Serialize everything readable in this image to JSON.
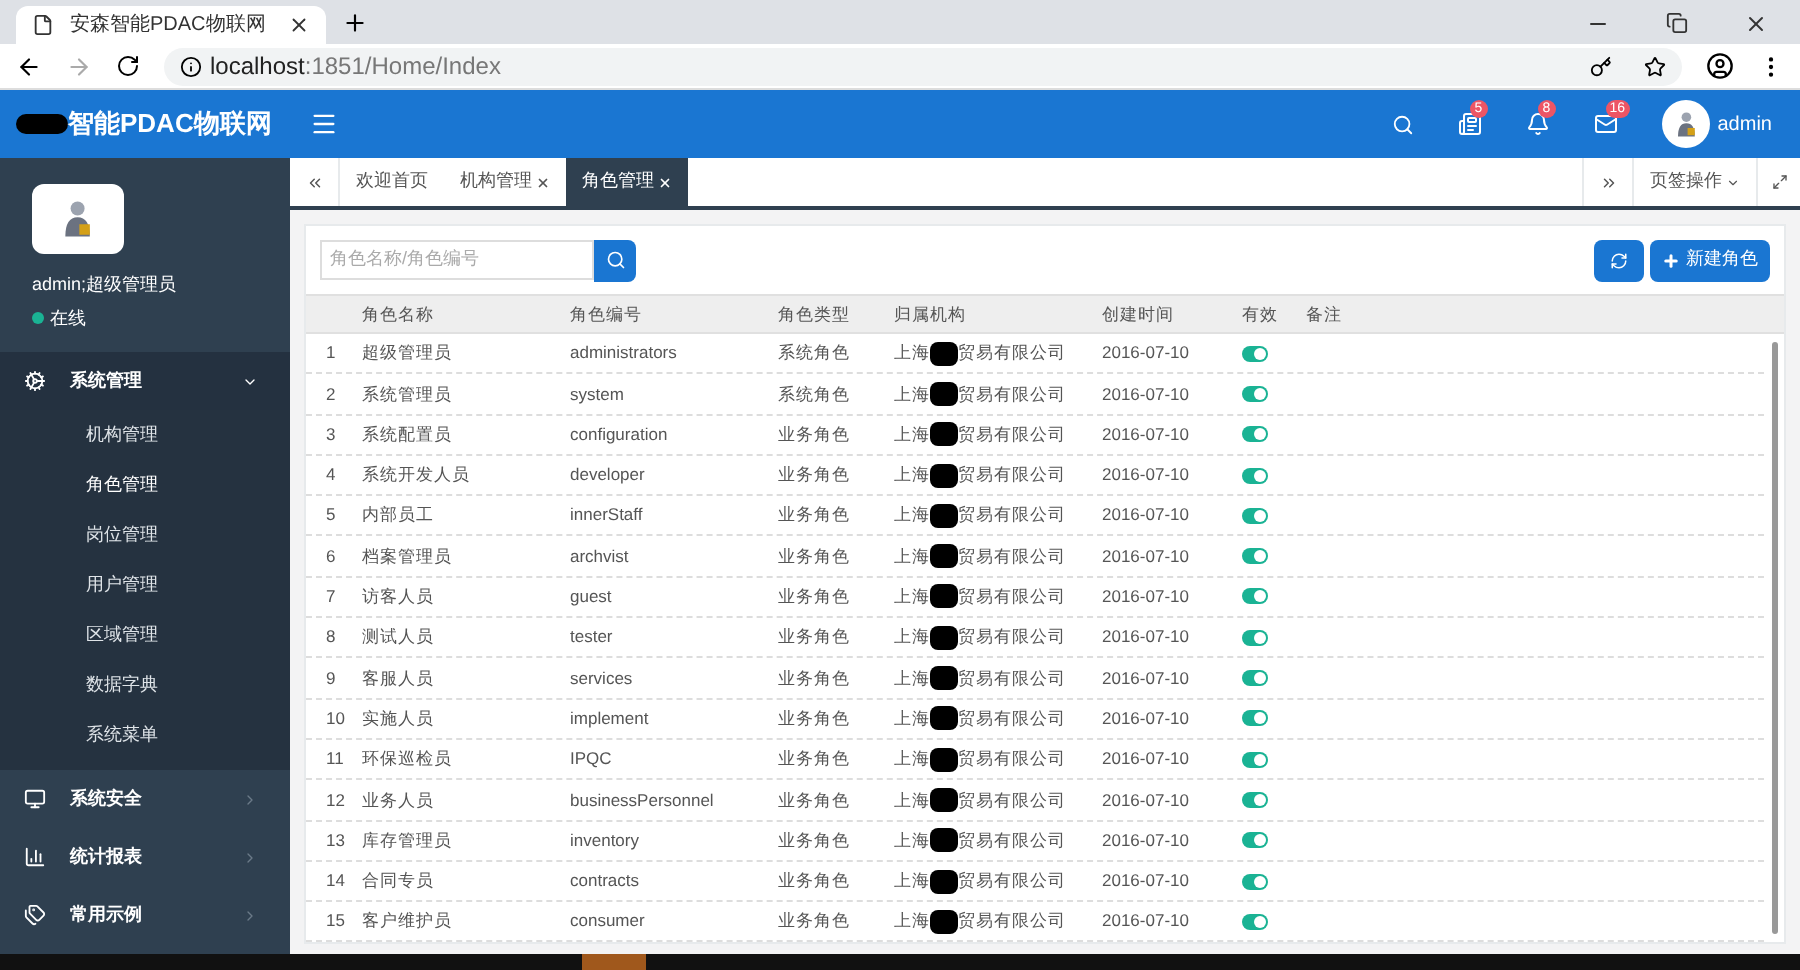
{
  "browser": {
    "tab_title": "安森智能PDAC物联网",
    "url_host": "localhost",
    "url_path": ":1851/Home/Index"
  },
  "header": {
    "logo": "智能PDAC物联网",
    "badges": [
      {
        "kind": "tasks",
        "count": "5"
      },
      {
        "kind": "bell",
        "count": "8"
      },
      {
        "kind": "mail",
        "count": "16"
      }
    ],
    "user": "admin"
  },
  "profile": {
    "name": "admin;超级管理员",
    "status": "在线",
    "color": "#1ab394"
  },
  "sidebar": {
    "items": [
      {
        "label": "系统管理",
        "kind": "gears",
        "expanded": true,
        "children": [
          {
            "label": "机构管理",
            "selected": false
          },
          {
            "label": "角色管理",
            "selected": true
          },
          {
            "label": "岗位管理",
            "selected": false
          },
          {
            "label": "用户管理",
            "selected": false
          },
          {
            "label": "区域管理",
            "selected": false
          },
          {
            "label": "数据字典",
            "selected": false
          },
          {
            "label": "系统菜单",
            "selected": false
          }
        ]
      },
      {
        "label": "系统安全",
        "kind": "monitor",
        "expanded": false
      },
      {
        "label": "统计报表",
        "kind": "chart",
        "expanded": false
      },
      {
        "label": "常用示例",
        "kind": "tags",
        "expanded": false
      }
    ]
  },
  "page_tabs": [
    {
      "label": "欢迎首页",
      "closable": false,
      "selected": false
    },
    {
      "label": "机构管理",
      "closable": true,
      "selected": false
    },
    {
      "label": "角色管理",
      "closable": true,
      "selected": true
    }
  ],
  "page_actions": "页签操作",
  "toolbar": {
    "search_placeholder": "角色名称/角色编号",
    "new_button": "新建角色"
  },
  "table": {
    "columns": [
      "角色名称",
      "角色编号",
      "角色类型",
      "归属机构",
      "创建时间",
      "有效",
      "备注"
    ],
    "rows": [
      {
        "no": "1",
        "name": "超级管理员",
        "code": "administrators",
        "type": "系统角色",
        "org_start": "上海",
        "org_end": "贸易有限公司",
        "date": "2016-07-10",
        "on": true
      },
      {
        "no": "2",
        "name": "系统管理员",
        "code": "system",
        "type": "系统角色",
        "org_start": "上海",
        "org_end": "贸易有限公司",
        "date": "2016-07-10",
        "on": true
      },
      {
        "no": "3",
        "name": "系统配置员",
        "code": "configuration",
        "type": "业务角色",
        "org_start": "上海",
        "org_end": "贸易有限公司",
        "date": "2016-07-10",
        "on": true
      },
      {
        "no": "4",
        "name": "系统开发人员",
        "code": "developer",
        "type": "业务角色",
        "org_start": "上海",
        "org_end": "贸易有限公司",
        "date": "2016-07-10",
        "on": true
      },
      {
        "no": "5",
        "name": "内部员工",
        "code": "innerStaff",
        "type": "业务角色",
        "org_start": "上海",
        "org_end": "贸易有限公司",
        "date": "2016-07-10",
        "on": true
      },
      {
        "no": "6",
        "name": "档案管理员",
        "code": "archvist",
        "type": "业务角色",
        "org_start": "上海",
        "org_end": "贸易有限公司",
        "date": "2016-07-10",
        "on": true
      },
      {
        "no": "7",
        "name": "访客人员",
        "code": "guest",
        "type": "业务角色",
        "org_start": "上海",
        "org_end": "贸易有限公司",
        "date": "2016-07-10",
        "on": true
      },
      {
        "no": "8",
        "name": "测试人员",
        "code": "tester",
        "type": "业务角色",
        "org_start": "上海",
        "org_end": "贸易有限公司",
        "date": "2016-07-10",
        "on": true
      },
      {
        "no": "9",
        "name": "客服人员",
        "code": "services",
        "type": "业务角色",
        "org_start": "上海",
        "org_end": "贸易有限公司",
        "date": "2016-07-10",
        "on": true
      },
      {
        "no": "10",
        "name": "实施人员",
        "code": "implement",
        "type": "业务角色",
        "org_start": "上海",
        "org_end": "贸易有限公司",
        "date": "2016-07-10",
        "on": true
      },
      {
        "no": "11",
        "name": "环保巡检员",
        "code": "IPQC",
        "type": "业务角色",
        "org_start": "上海",
        "org_end": "贸易有限公司",
        "date": "2016-07-10",
        "on": true
      },
      {
        "no": "12",
        "name": "业务人员",
        "code": "businessPersonnel",
        "type": "业务角色",
        "org_start": "上海",
        "org_end": "贸易有限公司",
        "date": "2016-07-10",
        "on": true
      },
      {
        "no": "13",
        "name": "库存管理员",
        "code": "inventory",
        "type": "业务角色",
        "org_start": "上海",
        "org_end": "贸易有限公司",
        "date": "2016-07-10",
        "on": true
      },
      {
        "no": "14",
        "name": "合同专员",
        "code": "contracts",
        "type": "业务角色",
        "org_start": "上海",
        "org_end": "贸易有限公司",
        "date": "2016-07-10",
        "on": true
      },
      {
        "no": "15",
        "name": "客户维护员",
        "code": "consumer",
        "type": "业务角色",
        "org_start": "上海",
        "org_end": "贸易有限公司",
        "date": "2016-07-10",
        "on": true
      }
    ]
  }
}
